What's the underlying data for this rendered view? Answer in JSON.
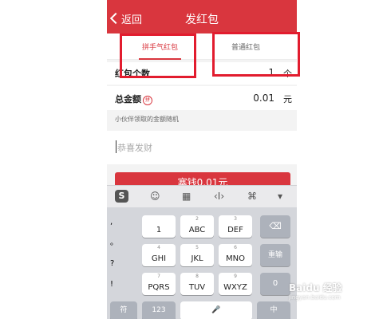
{
  "header": {
    "back_label": "返回",
    "title": "发红包"
  },
  "tabs": [
    {
      "label": "拼手气红包"
    },
    {
      "label": "普通红包"
    }
  ],
  "count_row": {
    "label": "红包个数",
    "value": "1",
    "unit": "个"
  },
  "amount_row": {
    "label": "总金额",
    "badge": "拼",
    "value": "0.01",
    "unit": "元"
  },
  "hint": "小伙伴领取的金额随机",
  "greeting_placeholder": "恭喜发财",
  "submit_label": "塞钱0.01元",
  "keyboard": {
    "toolbar": [
      "S",
      "☺",
      "▦",
      "‹I›",
      "⌘",
      "▾"
    ],
    "symbols": [
      ",",
      "。",
      "?",
      "!"
    ],
    "keys": [
      {
        "num": "",
        "label": "1"
      },
      {
        "num": "2",
        "label": "ABC"
      },
      {
        "num": "3",
        "label": "DEF"
      },
      {
        "num": "4",
        "label": "GHI"
      },
      {
        "num": "5",
        "label": "JKL"
      },
      {
        "num": "6",
        "label": "MNO"
      },
      {
        "num": "7",
        "label": "PQRS"
      },
      {
        "num": "8",
        "label": "TUV"
      },
      {
        "num": "9",
        "label": "WXYZ"
      }
    ],
    "right_keys": [
      "⌫",
      "重输",
      "0"
    ],
    "bottom": [
      "符",
      "123",
      "🎤",
      "中",
      "..."
    ]
  },
  "watermark": {
    "text": "Baidu 经验",
    "sub": "jingyan.baidu.com"
  },
  "colors": {
    "brand_red": "#d9363e",
    "annotation_red": "#e21c2e"
  }
}
